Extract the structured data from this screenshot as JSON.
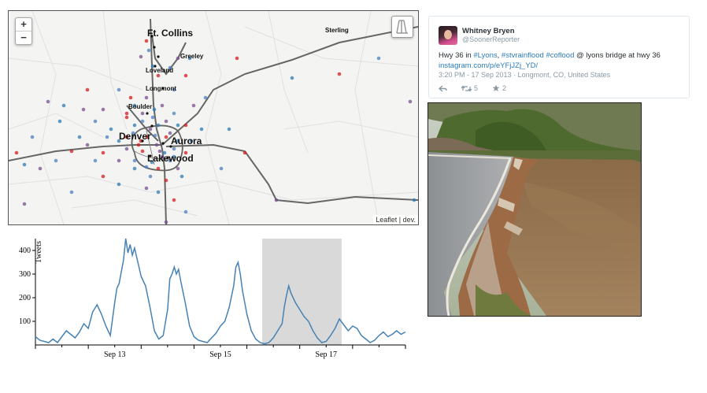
{
  "map": {
    "zoom_in": "+",
    "zoom_out": "−",
    "attribution": "Leaflet | dev.",
    "cities": {
      "ft_collins": "Ft. Collins",
      "sterling": "Sterling",
      "greeley": "Greeley",
      "loveland": "Loveland",
      "longmont": "Longmont",
      "boulder": "Boulder",
      "denver": "Denver",
      "aurora": "Aurora",
      "lakewood": "Lakewood"
    },
    "marker_colors": [
      "#d7191c",
      "#4a7fc1",
      "#7a4f8f",
      "#2c7bb6"
    ]
  },
  "chart": {
    "ylabel": "Tweets",
    "line_color": "#4682b4",
    "brush_color": "#d9d9d9"
  },
  "chart_data": {
    "type": "line",
    "title": "",
    "xlabel": "",
    "ylabel": "Tweets",
    "ylim": [
      0,
      450
    ],
    "x_ticks": [
      "Sep 13",
      "Sep 15",
      "Sep 17"
    ],
    "y_ticks": [
      100,
      200,
      300,
      400
    ],
    "x_domain_hours": [
      0,
      168
    ],
    "brush_hours": [
      103,
      139
    ],
    "series": [
      {
        "values": [
          [
            0,
            35
          ],
          [
            2,
            20
          ],
          [
            4,
            15
          ],
          [
            6,
            10
          ],
          [
            8,
            25
          ],
          [
            10,
            10
          ],
          [
            12,
            35
          ],
          [
            14,
            60
          ],
          [
            16,
            45
          ],
          [
            18,
            30
          ],
          [
            20,
            55
          ],
          [
            22,
            90
          ],
          [
            24,
            70
          ],
          [
            26,
            140
          ],
          [
            28,
            170
          ],
          [
            30,
            130
          ],
          [
            32,
            80
          ],
          [
            34,
            40
          ],
          [
            36,
            180
          ],
          [
            37,
            240
          ],
          [
            38,
            260
          ],
          [
            40,
            360
          ],
          [
            41,
            450
          ],
          [
            42,
            390
          ],
          [
            43,
            425
          ],
          [
            44,
            380
          ],
          [
            45,
            410
          ],
          [
            46,
            370
          ],
          [
            47,
            330
          ],
          [
            48,
            290
          ],
          [
            50,
            250
          ],
          [
            52,
            160
          ],
          [
            54,
            60
          ],
          [
            56,
            25
          ],
          [
            58,
            40
          ],
          [
            60,
            150
          ],
          [
            61,
            280
          ],
          [
            62,
            300
          ],
          [
            63,
            330
          ],
          [
            64,
            300
          ],
          [
            65,
            320
          ],
          [
            66,
            270
          ],
          [
            68,
            180
          ],
          [
            70,
            80
          ],
          [
            72,
            35
          ],
          [
            74,
            20
          ],
          [
            76,
            15
          ],
          [
            78,
            10
          ],
          [
            80,
            30
          ],
          [
            82,
            50
          ],
          [
            84,
            80
          ],
          [
            86,
            100
          ],
          [
            88,
            160
          ],
          [
            90,
            250
          ],
          [
            91,
            330
          ],
          [
            92,
            350
          ],
          [
            93,
            300
          ],
          [
            94,
            230
          ],
          [
            96,
            130
          ],
          [
            98,
            60
          ],
          [
            100,
            25
          ],
          [
            102,
            10
          ],
          [
            104,
            5
          ],
          [
            106,
            10
          ],
          [
            108,
            30
          ],
          [
            110,
            60
          ],
          [
            112,
            90
          ],
          [
            113,
            160
          ],
          [
            114,
            210
          ],
          [
            115,
            250
          ],
          [
            116,
            220
          ],
          [
            118,
            180
          ],
          [
            120,
            150
          ],
          [
            122,
            120
          ],
          [
            124,
            100
          ],
          [
            126,
            60
          ],
          [
            128,
            30
          ],
          [
            130,
            10
          ],
          [
            132,
            15
          ],
          [
            134,
            40
          ],
          [
            136,
            70
          ],
          [
            138,
            110
          ],
          [
            140,
            85
          ],
          [
            142,
            60
          ],
          [
            144,
            80
          ],
          [
            146,
            70
          ],
          [
            148,
            40
          ],
          [
            150,
            25
          ],
          [
            152,
            10
          ],
          [
            154,
            20
          ],
          [
            156,
            40
          ],
          [
            158,
            55
          ],
          [
            160,
            35
          ],
          [
            162,
            45
          ],
          [
            164,
            60
          ],
          [
            166,
            45
          ],
          [
            168,
            55
          ]
        ]
      }
    ]
  },
  "tweet": {
    "name": "Whitney Bryen",
    "handle": "@SoonerReporter",
    "text_prefix": "Hwy 36 in ",
    "hashtag1": "#Lyons",
    "sep1": ", ",
    "hashtag2": "#stvrainflood",
    "sep2": " ",
    "hashtag3": "#coflood",
    "text_mid": " @ lyons bridge at hwy 36",
    "link": "instagram.com/p/eYFjJZj_YD/",
    "timestamp": "3:20 PM - 17 Sep 2013 · Longmont, CO, United States",
    "retweets": "5",
    "favorites": "2",
    "icons": [
      "reply-icon",
      "retweet-icon",
      "favorite-icon"
    ]
  }
}
